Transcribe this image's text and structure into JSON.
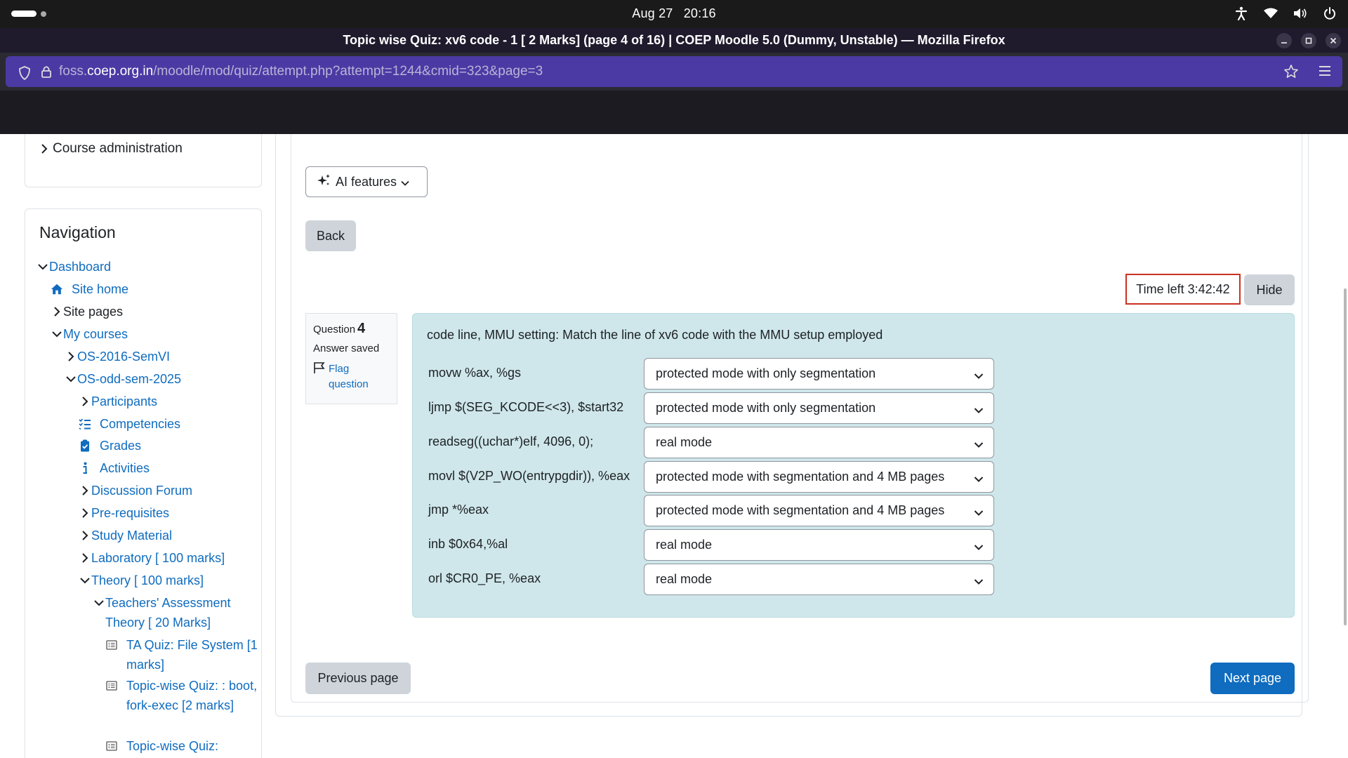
{
  "system": {
    "date": "Aug 27",
    "time": "20:16"
  },
  "browser": {
    "title": "Topic wise Quiz: xv6 code - 1 [ 2 Marks] (page 4 of 16) | COEP Moodle 5.0 (Dummy, Unstable) — Mozilla Firefox",
    "url_prefix": "foss.",
    "url_host": "coep.org.in",
    "url_path": "/moodle/mod/quiz/attempt.php?attempt=1244&cmid=323&page=3"
  },
  "sidebar": {
    "admin_link": "Course administration",
    "nav_title": "Navigation",
    "items": {
      "dashboard": "Dashboard",
      "site_home": "Site home",
      "site_pages": "Site pages",
      "my_courses": "My courses",
      "os2016": "OS-2016-SemVI",
      "os_odd": "OS-odd-sem-2025",
      "participants": "Participants",
      "competencies": "Competencies",
      "grades": "Grades",
      "activities": "Activities",
      "forum": "Discussion Forum",
      "prereq": "Pre-requisites",
      "study": "Study Material",
      "lab": "Laboratory [ 100 marks]",
      "theory": "Theory [ 100 marks]",
      "teachers": "Teachers' Assessment Theory [ 20 Marks]",
      "ta_quiz": "TA Quiz: File System [1 marks]",
      "topic_boot": "Topic-wise Quiz: : boot, fork-exec [2 marks]",
      "topic_next": "Topic-wise Quiz:"
    }
  },
  "main": {
    "ai_features": "AI features",
    "back": "Back",
    "timer": "Time left 3:42:42",
    "hide": "Hide",
    "question": {
      "label": "Question",
      "number": "4",
      "state": "Answer saved",
      "flag": "Flag question",
      "text": "code line, MMU setting: Match the line of xv6 code with the MMU setup employed",
      "rows": [
        {
          "stem": "movw %ax, %gs",
          "answer": "protected mode with only segmentation"
        },
        {
          "stem": "ljmp $(SEG_KCODE<<3), $start32",
          "answer": "protected mode with only segmentation"
        },
        {
          "stem": "readseg((uchar*)elf, 4096, 0);",
          "answer": "real mode"
        },
        {
          "stem": "movl $(V2P_WO(entrypgdir)), %eax",
          "answer": "protected mode with segmentation and 4 MB pages"
        },
        {
          "stem": "jmp *%eax",
          "answer": "protected mode with segmentation and 4 MB pages"
        },
        {
          "stem": "inb $0x64,%al",
          "answer": "real mode"
        },
        {
          "stem": "orl $CR0_PE, %eax",
          "answer": "real mode"
        }
      ]
    },
    "previous_page": "Previous page",
    "next_page": "Next page"
  },
  "colors": {
    "primary": "#0f6cbf",
    "question_bg": "#cfe7ea",
    "timer_border": "#ca3120",
    "url_bar": "#4b3aa3"
  }
}
